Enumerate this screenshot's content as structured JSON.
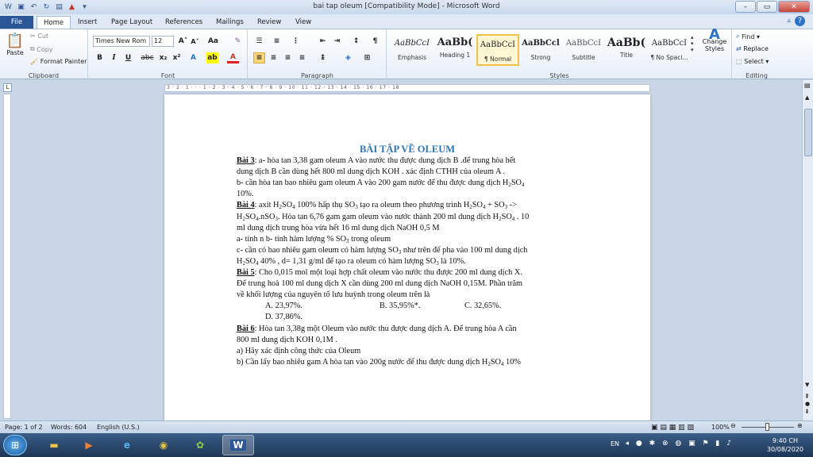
{
  "window": {
    "title": "bai tap oleum [Compatibility Mode] - Microsoft Word",
    "accent": "#2b5797"
  },
  "tabs": [
    "File",
    "Home",
    "Insert",
    "Page Layout",
    "References",
    "Mailings",
    "Review",
    "View"
  ],
  "ribbon": {
    "clipboard": {
      "paste": "Paste",
      "cut": "Cut",
      "copy": "Copy",
      "format_painter": "Format Painter",
      "label": "Clipboard"
    },
    "font": {
      "name": "Times New Rom",
      "size": "12",
      "label": "Font"
    },
    "paragraph": {
      "label": "Paragraph"
    },
    "styles": {
      "label": "Styles",
      "items": [
        {
          "sample": "AaBbCcI",
          "name": "Emphasis"
        },
        {
          "sample": "AaBb(",
          "name": "Heading 1"
        },
        {
          "sample": "AaBbCcI",
          "name": "¶ Normal"
        },
        {
          "sample": "AaBbCcl",
          "name": "Strong"
        },
        {
          "sample": "AaBbCcI",
          "name": "Subtitle"
        },
        {
          "sample": "AaBb(",
          "name": "Title"
        },
        {
          "sample": "AaBbCcI",
          "name": "¶ No Spaci..."
        }
      ],
      "change_styles": "Change Styles"
    },
    "editing": {
      "find": "Find",
      "replace": "Replace",
      "select": "Select",
      "label": "Editing"
    }
  },
  "ruler": {
    "marks": "3 · 2 · 1 · · · 1 · 2 · 3 · 4 · 5 · 6 · 7 · 8 · 9 · 10 · 11 · 12 · 13 · 14 · 15 · 16 · 17 · 18"
  },
  "document": {
    "title": "BÀI TẬP VỀ OLEUM",
    "b3_label": "Bài 3",
    "b3_l1": ": a- hòa tan 3,38 gam oleum A vào nước thu được dung dịch B .để trung hòa hết",
    "b3_l2": "dung dịch B cần dùng hết 800 ml dung dịch KOH . xác định CTHH của oleum A .",
    "b3_l3a": " b- cần hòa tan bao nhiêu gam oleum A vào 200 gam nước để thu được dung dịch H",
    "b3_l3b": "SO",
    "b3_l4": "10%.",
    "b4_label": "Bài 4",
    "b4_l1a": ": axit H",
    "b4_l1b": "SO",
    "b4_l1c": " 100% hấp thụ SO",
    "b4_l1d": " tạo ra oleum theo phương trình H",
    "b4_l1e": "SO",
    "b4_l1f": " +  SO",
    "b4_l1g": " ->",
    "b4_l2a": "H",
    "b4_l2b": "SO",
    "b4_l2c": ".nSO",
    "b4_l2d": ". Hòa tan 6,76 gam gam oleum vào nước thành 200 ml dung dịch H",
    "b4_l2e": "SO",
    "b4_l2f": " . 10",
    "b4_l3": "ml  dung dịch trung hòa vừa hết 16 ml dung dịch NaOH 0,5 M",
    "b4_l4a": " a- tính n b- tính hàm lượng % SO",
    "b4_l4b": " trong oleum",
    "b4_l5a": "c- cần có bao nhiêu gam oleum có hàm lượng SO",
    "b4_l5b": " như trên để pha vào 100 ml dung dịch",
    "b4_l6a": "H",
    "b4_l6b": "SO",
    "b4_l6c": " 40% , d= 1,31 g/ml để tạo  ra oleum có hàm lượng SO",
    "b4_l6d": " là 10%.",
    "b5_label": "Bài 5",
    "b5_l1": ": Cho 0,015 mol một loại hợp chất oleum vào nước thu được 200 ml dung dịch X.",
    "b5_l2": "Để trung hoà 100 ml dung dịch X cần dùng 200 ml dung dịch NaOH 0,15M. Phần trăm",
    "b5_l3": "về khối lượng của nguyên tố lưu huỳnh trong oleum trên là",
    "b5_opt_a": "A. 23,97%.",
    "b5_opt_b": "B. 35,95%*.",
    "b5_opt_c": "C. 32,65%.",
    "b5_opt_d": "D. 37,86%.",
    "b6_label": "Bài 6",
    "b6_l1": ": Hòa tan 3,38g một Oleum vào nước thu được dung dịch A. Để trung hòa A cần",
    "b6_l2": "800 ml  dung dịch KOH 0,1M .",
    "b6_l3": "a) Hãy xác định  công thức của Oleum",
    "b6_l4a": "b) Cần lấy bao nhiêu gam A hòa tan vào 200g nước để thu được dung dịch H",
    "b6_l4b": "SO",
    "b6_l4c": " 10%",
    "sub2": "2",
    "sub3": "3",
    "sub4": "4"
  },
  "status": {
    "page": "Page: 1 of 2",
    "words": "Words: 604",
    "language": "English (U.S.)",
    "zoom": "100%"
  },
  "taskbar": {
    "lang": "EN",
    "time": "9:40 CH",
    "date": "30/08/2020"
  }
}
